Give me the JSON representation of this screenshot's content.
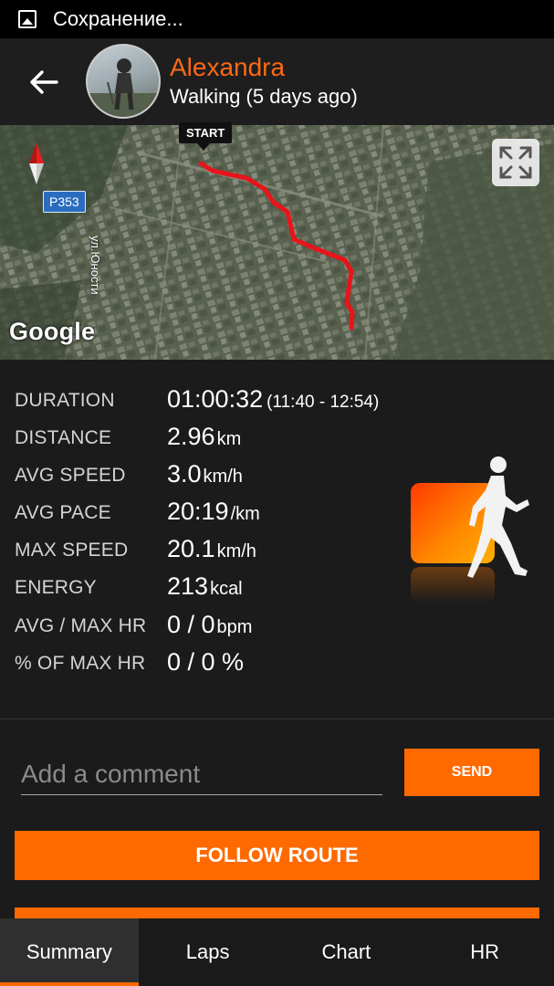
{
  "status_bar": {
    "text": "Сохранение..."
  },
  "header": {
    "name": "Alexandra",
    "subtitle": "Walking (5 days ago)"
  },
  "map": {
    "start_label": "START",
    "road_label": "Р353",
    "street_label": "ул.Юности",
    "google_label": "Google",
    "route_color": "#e8141a"
  },
  "stats": [
    {
      "label": "DURATION",
      "value": "01:00:32",
      "unit": "",
      "extra": "(11:40 - 12:54)"
    },
    {
      "label": "DISTANCE",
      "value": "2.96",
      "unit": "km",
      "extra": ""
    },
    {
      "label": "AVG SPEED",
      "value": "3.0",
      "unit": "km/h",
      "extra": ""
    },
    {
      "label": "AVG PACE",
      "value": "20:19",
      "unit": "/km",
      "extra": ""
    },
    {
      "label": "MAX SPEED",
      "value": "20.1",
      "unit": "km/h",
      "extra": ""
    },
    {
      "label": "ENERGY",
      "value": "213",
      "unit": "kcal",
      "extra": ""
    },
    {
      "label": "AVG / MAX HR",
      "value": "0 / 0",
      "unit": "bpm",
      "extra": ""
    },
    {
      "label": "% OF MAX HR",
      "value": "0 / 0 %",
      "unit": "",
      "extra": ""
    }
  ],
  "comment": {
    "placeholder": "Add a comment",
    "value": "",
    "send_label": "SEND"
  },
  "follow_route_label": "FOLLOW ROUTE",
  "tabs": [
    {
      "label": "Summary",
      "active": true
    },
    {
      "label": "Laps",
      "active": false
    },
    {
      "label": "Chart",
      "active": false
    },
    {
      "label": "HR",
      "active": false
    }
  ],
  "colors": {
    "accent": "#ff6a00",
    "name": "#ff6a14",
    "background": "#1b1b1b"
  },
  "icons": {
    "status": "image-icon",
    "back": "back-arrow-icon",
    "compass": "compass-icon",
    "fullscreen": "fullscreen-icon",
    "activity": "walking-activity-icon"
  }
}
